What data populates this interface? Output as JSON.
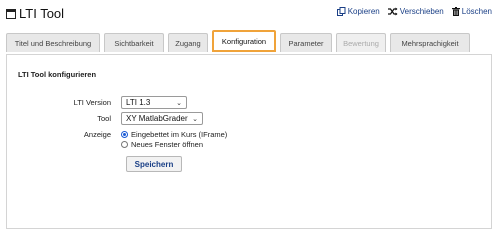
{
  "header": {
    "title": "LTI Tool",
    "actions": [
      {
        "label": "Kopieren",
        "icon": "copy-icon"
      },
      {
        "label": "Verschieben",
        "icon": "shuffle-icon"
      },
      {
        "label": "Löschen",
        "icon": "trash-icon"
      }
    ]
  },
  "tabs": [
    {
      "label": "Titel und Beschreibung",
      "state": "normal"
    },
    {
      "label": "Sichtbarkeit",
      "state": "normal"
    },
    {
      "label": "Zugang",
      "state": "normal"
    },
    {
      "label": "Konfiguration",
      "state": "active"
    },
    {
      "label": "Parameter",
      "state": "normal"
    },
    {
      "label": "Bewertung",
      "state": "disabled"
    },
    {
      "label": "Mehrsprachigkeit",
      "state": "normal"
    }
  ],
  "form": {
    "section_title": "LTI Tool konfigurieren",
    "lti_version_label": "LTI Version",
    "lti_version_value": "LTI 1.3",
    "tool_label": "Tool",
    "tool_value": "XY MatlabGrader",
    "display_label": "Anzeige",
    "display_options": [
      {
        "label": "Eingebettet im Kurs (IFrame)",
        "checked": true
      },
      {
        "label": "Neues Fenster öffnen",
        "checked": false
      }
    ],
    "save_label": "Speichern"
  },
  "colors": {
    "accent_active_tab": "#f0a33a",
    "link": "#1a3f86",
    "radio_checked": "#1a5bd6"
  }
}
